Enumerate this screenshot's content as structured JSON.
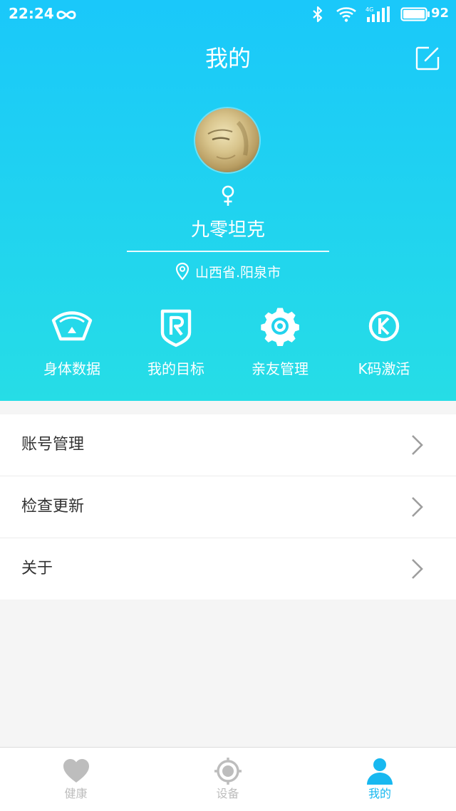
{
  "status_bar": {
    "time": "22:24",
    "battery": "92",
    "network": "4G"
  },
  "header": {
    "title": "我的",
    "edit_icon": "edit-icon",
    "profile": {
      "gender_symbol": "♀",
      "name": "九零坦克",
      "location": "山西省.阳泉市"
    }
  },
  "quick_actions": [
    {
      "label": "身体数据",
      "icon": "body-data-icon"
    },
    {
      "label": "我的目标",
      "icon": "goal-icon"
    },
    {
      "label": "亲友管理",
      "icon": "friends-icon"
    },
    {
      "label": "K码激活",
      "icon": "k-code-icon"
    }
  ],
  "menu": [
    {
      "label": "账号管理"
    },
    {
      "label": "检查更新"
    },
    {
      "label": "关于"
    }
  ],
  "tabs": [
    {
      "label": "健康",
      "icon": "heart-icon",
      "active": false
    },
    {
      "label": "设备",
      "icon": "device-icon",
      "active": false
    },
    {
      "label": "我的",
      "icon": "person-icon",
      "active": true
    }
  ],
  "colors": {
    "header_top": "#1ac8fa",
    "header_bottom": "#26dde6",
    "tab_active": "#18b8f0",
    "tab_inactive": "#bdbdbd",
    "chevron": "#9e9e9e"
  }
}
